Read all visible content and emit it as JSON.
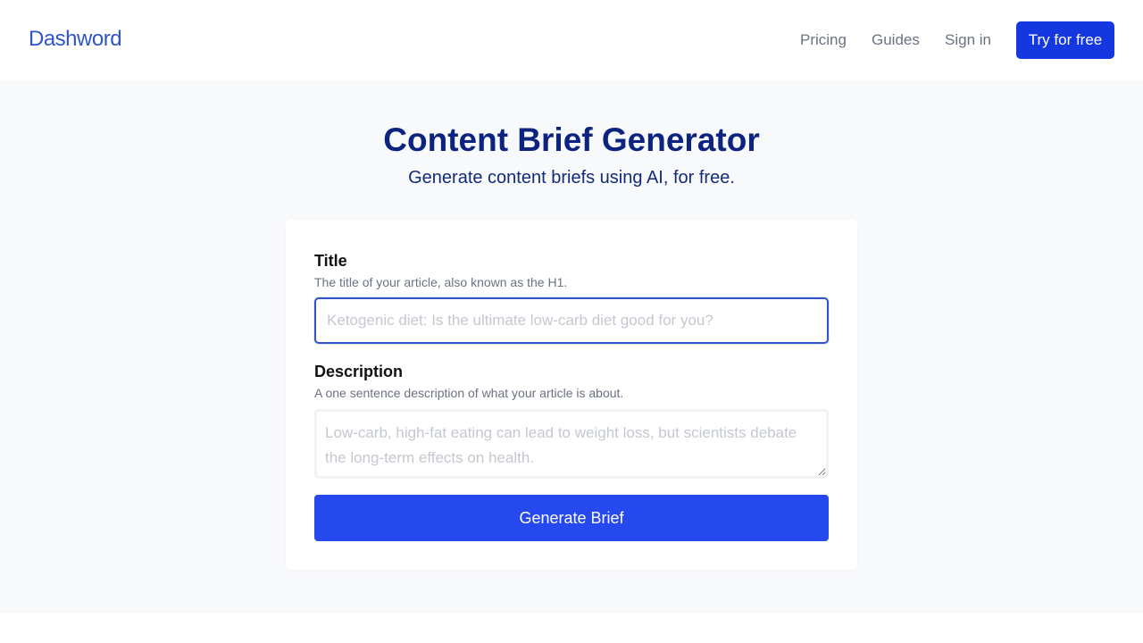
{
  "nav": {
    "logo": "Dashword",
    "links": [
      "Pricing",
      "Guides",
      "Sign in"
    ],
    "cta": "Try for free"
  },
  "hero": {
    "title": "Content Brief Generator",
    "subtitle": "Generate content briefs using AI, for free."
  },
  "form": {
    "title_field": {
      "label": "Title",
      "help": "The title of your article, also known as the H1.",
      "placeholder": "Ketogenic diet: Is the ultimate low-carb diet good for you?",
      "value": ""
    },
    "description_field": {
      "label": "Description",
      "help": "A one sentence description of what your article is about.",
      "placeholder": "Low-carb, high-fat eating can lead to weight loss, but scientists debate the long-term effects on health.",
      "value": ""
    },
    "submit_label": "Generate Brief"
  },
  "colors": {
    "brand": "#2f55c8",
    "primary_button": "#2549ee",
    "cta_button": "#1437e0",
    "heading": "#0d2380",
    "page_background": "#f8f9fb"
  }
}
